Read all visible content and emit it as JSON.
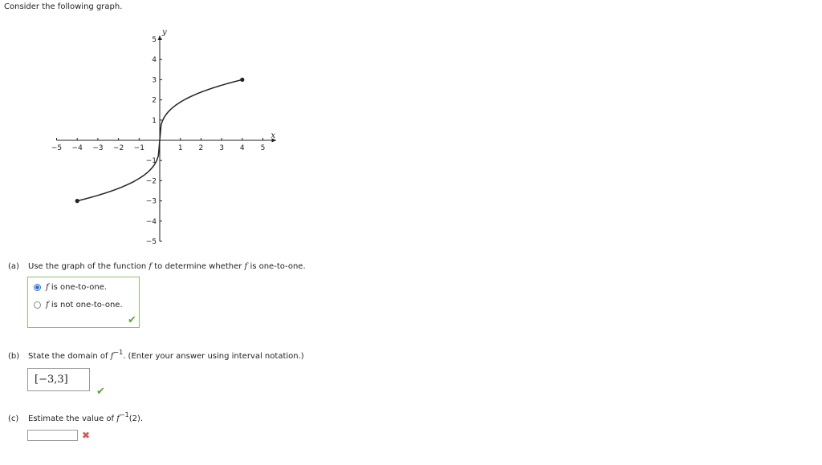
{
  "intro": "Consider the following graph.",
  "graph": {
    "x_label": "x",
    "y_label": "y",
    "x_ticks": [
      "-5",
      "-4",
      "-3",
      "-2",
      "-1",
      "1",
      "2",
      "3",
      "4",
      "5"
    ],
    "y_ticks": [
      "5",
      "4",
      "3",
      "2",
      "1",
      "-1",
      "-2",
      "-3",
      "-4",
      "-5"
    ],
    "xlim": [
      -5,
      5
    ],
    "ylim": [
      -5,
      5
    ],
    "curve": "y = x^(1/3) type curve through (-4,-3), (0,0), (4,3) with endpoint dots",
    "endpoints": [
      [
        -4,
        -3
      ],
      [
        4,
        3
      ]
    ],
    "curve_color": "#222222"
  },
  "part_a": {
    "label": "(a)",
    "prompt_pre": "Use the graph of the function",
    "f1": "f",
    "prompt_mid": "to determine whether",
    "f2": "f",
    "prompt_post": "is one-to-one.",
    "options": [
      {
        "f": "f",
        "text": "is one-to-one.",
        "selected": true
      },
      {
        "f": "f",
        "text": "is not one-to-one.",
        "selected": false
      }
    ],
    "mark": "✔"
  },
  "part_b": {
    "label": "(b)",
    "prompt_pre": "State the domain of",
    "f": "f",
    "sup": "−1",
    "prompt_post": ". (Enter your answer using interval notation.)",
    "answer": "[−3,3]",
    "mark": "✔"
  },
  "part_c": {
    "label": "(c)",
    "prompt_pre": "Estimate the value of",
    "f": "f",
    "sup": "−1",
    "prompt_post": "(2).",
    "input_value": "",
    "mark": "✖"
  },
  "colors": {
    "correct": "#5aa832",
    "incorrect": "#d9534f",
    "box_border_correct": "#8dc26f",
    "radio_selected": "#2a6fd6"
  }
}
